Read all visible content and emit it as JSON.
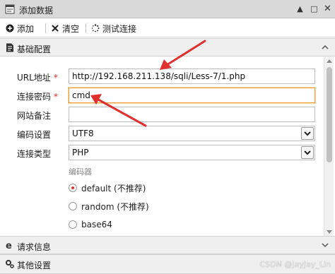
{
  "window": {
    "title": "添加数据",
    "controls": [
      "collapse",
      "maximize",
      "close"
    ]
  },
  "toolbar": {
    "add_label": "添加",
    "clear_label": "清空",
    "test_label": "测试连接"
  },
  "sections": {
    "basic": "基础配置",
    "request": "请求信息",
    "other": "其他设置"
  },
  "form": {
    "url_label": "URL地址",
    "url_value": "http://192.168.211.138/sqli/Less-7/1.php",
    "password_label": "连接密码",
    "password_value": "cmd",
    "note_label": "网站备注",
    "note_value": "",
    "encoding_label": "编码设置",
    "encoding_value": "UTF8",
    "type_label": "连接类型",
    "type_value": "PHP",
    "required_mark": "*",
    "encoder_title": "编码器",
    "encoders": [
      {
        "label": "default (不推荐)",
        "checked": true
      },
      {
        "label": "random (不推荐)",
        "checked": false
      },
      {
        "label": "base64",
        "checked": false
      }
    ]
  },
  "watermark": "CSDN @JayJay_Lin",
  "colors": {
    "arrow": "#e03030",
    "focus_border": "#f0a23a",
    "header_bg": "#efefef",
    "titlebar_bg": "#d9d9d9"
  }
}
